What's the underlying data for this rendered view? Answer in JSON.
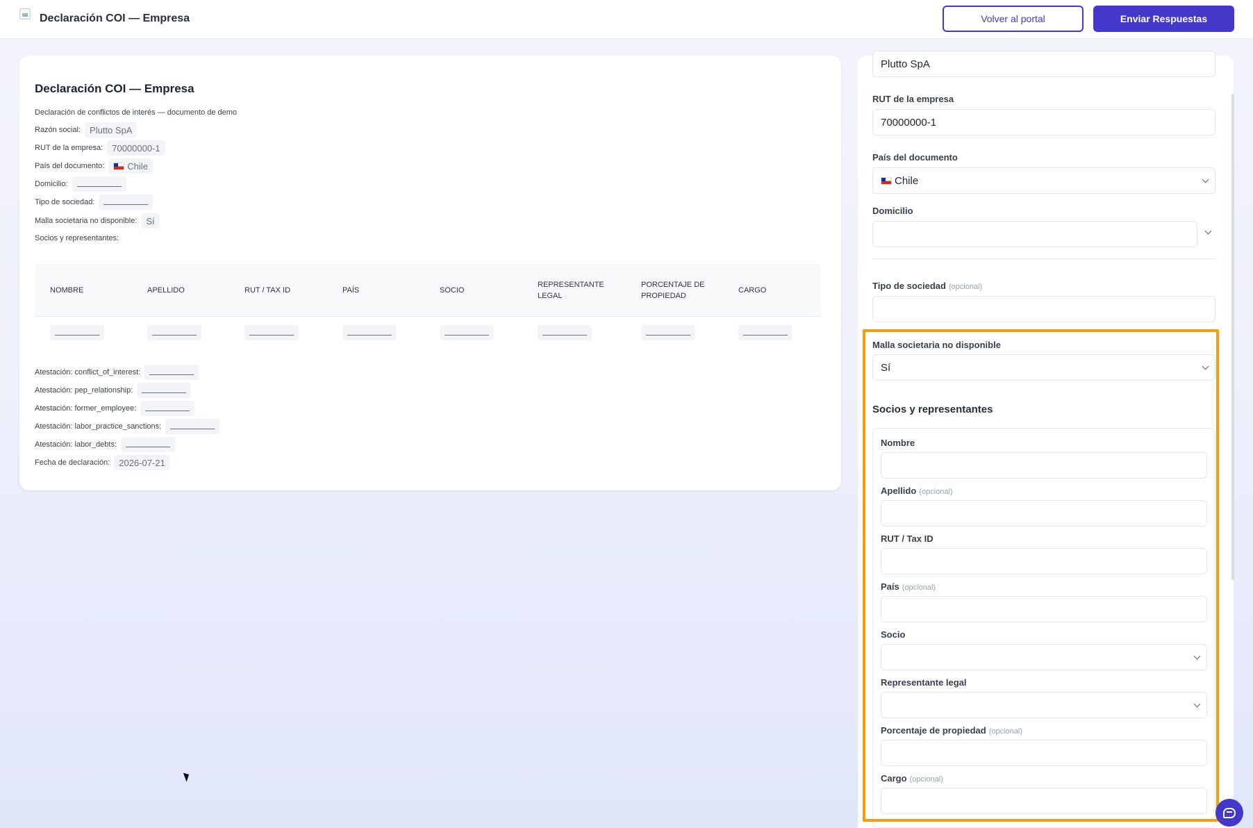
{
  "header": {
    "title": "Declaración COI — Empresa",
    "back_button": "Volver al portal",
    "submit_button": "Enviar Respuestas"
  },
  "doc": {
    "title": "Declaración COI — Empresa",
    "subtitle": "Declaración de conflictos de interés — documento de demo",
    "fields": [
      {
        "label": "Razón social:",
        "value": "Plutto SpA"
      },
      {
        "label": "RUT de la empresa:",
        "value": "70000000-1"
      },
      {
        "label": "País del documento:",
        "value": "Chile"
      },
      {
        "label": "Domicilio:",
        "value": ""
      },
      {
        "label": "Tipo de sociedad:",
        "value": ""
      },
      {
        "label": "Malla societaria no disponible:",
        "value": "Sí"
      },
      {
        "label": "Socios y representantes:",
        "value": ""
      }
    ],
    "table_headers": [
      "NOMBRE",
      "APELLIDO",
      "RUT / TAX ID",
      "PAÍS",
      "SOCIO",
      "REPRESENTANTE LEGAL",
      "PORCENTAJE DE PROPIEDAD",
      "CARGO"
    ],
    "attestations": [
      {
        "label": "Atestación: conflict_of_interest:",
        "value": ""
      },
      {
        "label": "Atestación: pep_relationship:",
        "value": ""
      },
      {
        "label": "Atestación: former_employee:",
        "value": ""
      },
      {
        "label": "Atestación: labor_practice_sanctions:",
        "value": ""
      },
      {
        "label": "Atestación: labor_debts:",
        "value": ""
      },
      {
        "label": "Fecha de declaración:",
        "value": "2026-07-21"
      }
    ]
  },
  "form": {
    "razon_social_value": "Plutto SpA",
    "rut_label": "RUT de la empresa",
    "rut_value": "70000000-1",
    "pais_label": "País del documento",
    "pais_value": "Chile",
    "domicilio_label": "Domicilio",
    "tipo_label": "Tipo de sociedad",
    "optional_tag": "(opcional)",
    "malla_label": "Malla societaria no disponible",
    "malla_value": "Sí",
    "socios_title": "Socios y representantes",
    "socios_fields": {
      "nombre": "Nombre",
      "apellido": "Apellido",
      "rut": "RUT / Tax ID",
      "pais": "País",
      "socio": "Socio",
      "representante": "Representante legal",
      "porcentaje": "Porcentaje de propiedad",
      "cargo": "Cargo"
    }
  },
  "icons": {
    "flag": "chile-flag-icon",
    "chevron": "chevron-down-icon",
    "chat": "chat-icon",
    "cursor": "mouse-cursor-icon"
  },
  "colors": {
    "accent": "#4338ca",
    "highlight": "#f59e0b"
  }
}
